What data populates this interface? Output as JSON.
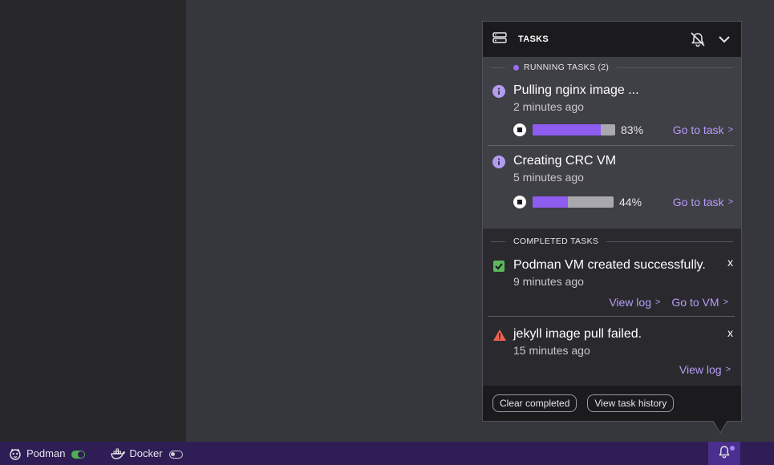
{
  "panel": {
    "title": "TASKS",
    "running_label": "RUNNING TASKS (2)",
    "completed_label": "COMPLETED TASKS",
    "running_tasks": [
      {
        "title": "Pulling nginx image ...",
        "time": "2 minutes ago",
        "progress": 83,
        "progress_label": "83%",
        "link": "Go to task"
      },
      {
        "title": "Creating CRC VM",
        "time": "5 minutes ago",
        "progress": 44,
        "progress_label": "44%",
        "link": "Go to task"
      }
    ],
    "completed_tasks": [
      {
        "title": "Podman VM created successfully.",
        "time": "9 minutes ago",
        "status": "success",
        "close": "x",
        "links": [
          "View log",
          "Go to VM"
        ]
      },
      {
        "title": "jekyll image pull failed.",
        "time": "15 minutes ago",
        "status": "error",
        "close": "x",
        "links": [
          "View log"
        ]
      }
    ],
    "footer": {
      "clear_label": "Clear completed",
      "history_label": "View task history"
    }
  },
  "statusbar": {
    "items": [
      {
        "label": "Podman",
        "icon": "podman-icon",
        "enabled": true
      },
      {
        "label": "Docker",
        "icon": "docker-icon",
        "enabled": false
      }
    ]
  },
  "colors": {
    "accent": "#8e5cf0",
    "link": "#b79cf7",
    "success": "#4caf50",
    "error": "#f0624f",
    "statusbar": "#2f1d56"
  }
}
